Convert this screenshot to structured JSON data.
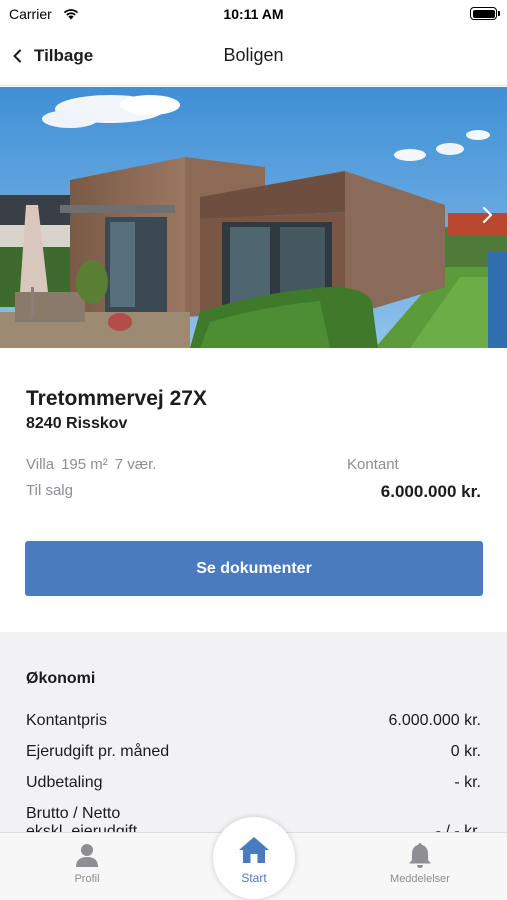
{
  "status_bar": {
    "carrier": "Carrier",
    "time": "10:11 AM"
  },
  "nav": {
    "back_label": "Tilbage",
    "title": "Boligen"
  },
  "property": {
    "address": "Tretommervej 27X",
    "city": "8240 Risskov",
    "type": "Villa",
    "area": "195 m²",
    "rooms": "7 vær.",
    "status": "Til salg",
    "price_label": "Kontant",
    "price": "6.000.000 kr."
  },
  "documents_button": "Se dokumenter",
  "economy": {
    "title": "Økonomi",
    "rows": [
      {
        "label": "Kontantpris",
        "value": "6.000.000 kr."
      },
      {
        "label": "Ejerudgift pr. måned",
        "value": "0 kr."
      },
      {
        "label": "Udbetaling",
        "value": "- kr."
      },
      {
        "label": "Brutto / Netto",
        "sub": "ekskl. ejerudgift",
        "value": "- / - kr."
      }
    ]
  },
  "tabs": [
    {
      "label": "Profil",
      "icon": "person-icon"
    },
    {
      "label": "Start",
      "icon": "home-icon"
    },
    {
      "label": "Meddelelser",
      "icon": "bell-icon"
    }
  ],
  "colors": {
    "accent": "#4a7bbf",
    "section_bg": "#f2f2f4",
    "muted_text": "#8e8e93"
  }
}
